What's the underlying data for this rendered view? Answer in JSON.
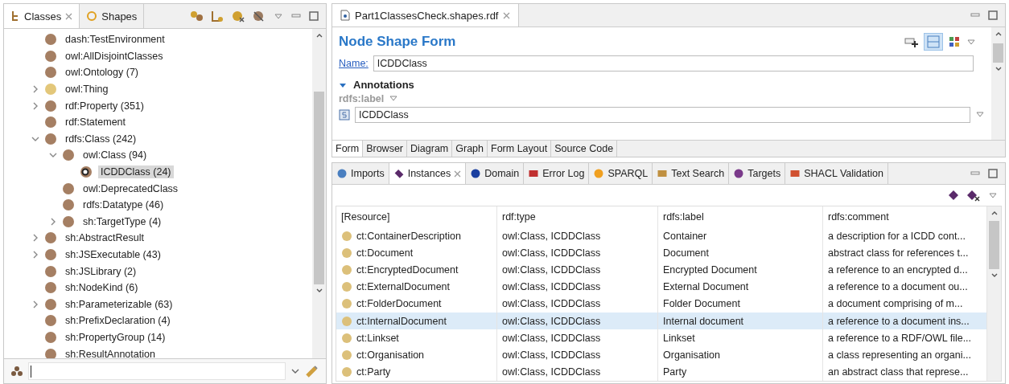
{
  "left_panel": {
    "tabs": [
      {
        "label": "Classes",
        "selected": true,
        "closable": true
      },
      {
        "label": "Shapes",
        "selected": false,
        "closable": false
      }
    ],
    "tree": [
      {
        "label": "dash:TestEnvironment",
        "color": "#a57f63",
        "selected": false
      },
      {
        "label": "owl:AllDisjointClasses",
        "color": "#a57f63",
        "selected": false
      },
      {
        "label": "owl:Ontology  (7)",
        "color": "#a57f63",
        "selected": false
      },
      {
        "label": "owl:Thing",
        "color": "#e3c77a",
        "selected": false,
        "expanded": false
      },
      {
        "label": "rdf:Property  (351)",
        "color": "#a57f63",
        "selected": false,
        "expanded": false
      },
      {
        "label": "rdf:Statement",
        "color": "#a57f63",
        "selected": false
      },
      {
        "label": "rdfs:Class  (242)",
        "color": "#a57f63",
        "selected": false,
        "expanded": true,
        "children": [
          {
            "label": "owl:Class  (94)",
            "color": "#a57f63",
            "selected": false,
            "expanded": true,
            "children": [
              {
                "label": "ICDDClass  (24)",
                "color": "#a57f63",
                "selected": true
              }
            ]
          },
          {
            "label": "owl:DeprecatedClass",
            "color": "#a57f63",
            "selected": false
          },
          {
            "label": "rdfs:Datatype  (46)",
            "color": "#a57f63",
            "selected": false
          },
          {
            "label": "sh:TargetType  (4)",
            "color": "#a57f63",
            "selected": false,
            "expanded": false
          }
        ]
      },
      {
        "label": "sh:AbstractResult",
        "color": "#a57f63",
        "selected": false,
        "expanded": false
      },
      {
        "label": "sh:JSExecutable  (43)",
        "color": "#a57f63",
        "selected": false,
        "expanded": false
      },
      {
        "label": "sh:JSLibrary  (2)",
        "color": "#a57f63",
        "selected": false
      },
      {
        "label": "sh:NodeKind  (6)",
        "color": "#a57f63",
        "selected": false
      },
      {
        "label": "sh:Parameterizable  (63)",
        "color": "#a57f63",
        "selected": false,
        "expanded": false
      },
      {
        "label": "sh:PrefixDeclaration  (4)",
        "color": "#a57f63",
        "selected": false
      },
      {
        "label": "sh:PropertyGroup  (14)",
        "color": "#a57f63",
        "selected": false
      },
      {
        "label": "sh:ResultAnnotation",
        "color": "#a57f63",
        "selected": false
      }
    ]
  },
  "editor": {
    "tab": "Part1ClassesCheck.shapes.rdf",
    "title": "Node Shape Form",
    "name_label": "Name:",
    "name_value": "ICDDClass",
    "section": "Annotations",
    "property": "rdfs:label",
    "property_value": "ICDDClass",
    "bottom_tabs": [
      {
        "label": "Form",
        "selected": true
      },
      {
        "label": "Browser",
        "selected": false
      },
      {
        "label": "Diagram",
        "selected": false
      },
      {
        "label": "Graph",
        "selected": false
      },
      {
        "label": "Form Layout",
        "selected": false
      },
      {
        "label": "Source Code",
        "selected": false
      }
    ]
  },
  "views": {
    "tabs": [
      {
        "label": "Imports",
        "selected": false
      },
      {
        "label": "Instances",
        "selected": true
      },
      {
        "label": "Domain",
        "selected": false
      },
      {
        "label": "Error Log",
        "selected": false
      },
      {
        "label": "SPARQL",
        "selected": false
      },
      {
        "label": "Text Search",
        "selected": false
      },
      {
        "label": "Targets",
        "selected": false
      },
      {
        "label": "SHACL Validation",
        "selected": false
      }
    ],
    "table": {
      "columns": [
        "[Resource]",
        "rdf:type",
        "rdfs:label",
        "rdfs:comment"
      ],
      "rows": [
        {
          "cells": [
            "ct:ContainerDescription",
            "owl:Class, ICDDClass",
            "Container",
            "a description for a ICDD cont..."
          ],
          "selected": false
        },
        {
          "cells": [
            "ct:Document",
            "owl:Class, ICDDClass",
            "Document",
            "abstract class for references t..."
          ],
          "selected": false
        },
        {
          "cells": [
            "ct:EncryptedDocument",
            "owl:Class, ICDDClass",
            "Encrypted Document",
            "a reference to an encrypted d..."
          ],
          "selected": false
        },
        {
          "cells": [
            "ct:ExternalDocument",
            "owl:Class, ICDDClass",
            "External Document",
            "a reference to a document ou..."
          ],
          "selected": false
        },
        {
          "cells": [
            "ct:FolderDocument",
            "owl:Class, ICDDClass",
            "Folder Document",
            "a document comprising of m..."
          ],
          "selected": false
        },
        {
          "cells": [
            "ct:InternalDocument",
            "owl:Class, ICDDClass",
            "Internal document",
            "a reference to a document ins..."
          ],
          "selected": true
        },
        {
          "cells": [
            "ct:Linkset",
            "owl:Class, ICDDClass",
            "Linkset",
            "a reference to a RDF/OWL file..."
          ],
          "selected": false
        },
        {
          "cells": [
            "ct:Organisation",
            "owl:Class, ICDDClass",
            "Organisation",
            "a class representing an organi..."
          ],
          "selected": false
        },
        {
          "cells": [
            "ct:Party",
            "owl:Class, ICDDClass",
            "Party",
            "an abstract class that represe..."
          ],
          "selected": false
        }
      ]
    }
  }
}
